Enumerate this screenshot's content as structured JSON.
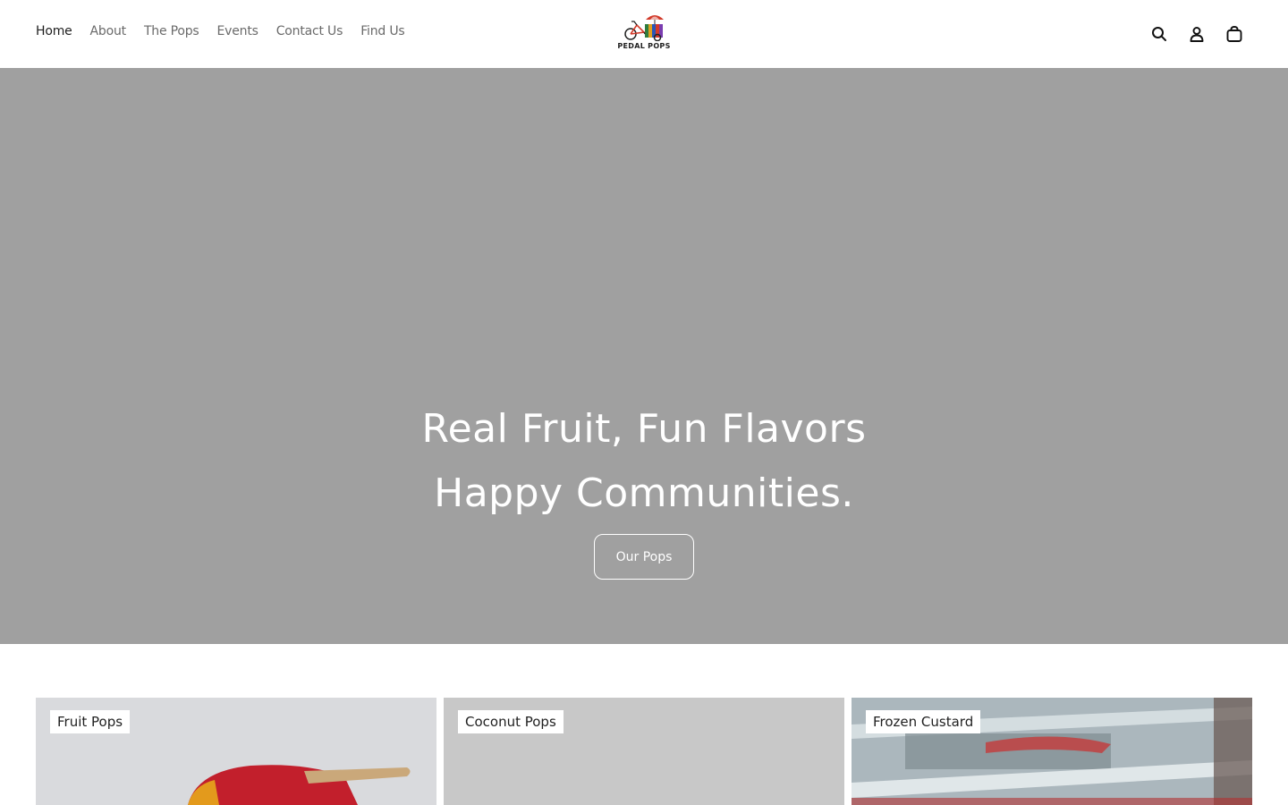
{
  "nav": {
    "items": [
      {
        "label": "Home",
        "active": true
      },
      {
        "label": "About",
        "active": false
      },
      {
        "label": "The Pops",
        "active": false
      },
      {
        "label": "Events",
        "active": false
      },
      {
        "label": "Contact Us",
        "active": false
      },
      {
        "label": "Find Us",
        "active": false
      }
    ]
  },
  "brand": {
    "logo_text": "PEDAL POPS"
  },
  "header_icons": [
    "search-icon",
    "account-icon",
    "cart-icon"
  ],
  "hero": {
    "title_line_1": "Real Fruit, Fun Flavors",
    "title_line_2": "Happy Communities.",
    "button_label": "Our Pops",
    "background_color": "#a0a0a0"
  },
  "collections": [
    {
      "label": "Fruit Pops"
    },
    {
      "label": "Coconut Pops"
    },
    {
      "label": "Frozen Custard"
    }
  ]
}
